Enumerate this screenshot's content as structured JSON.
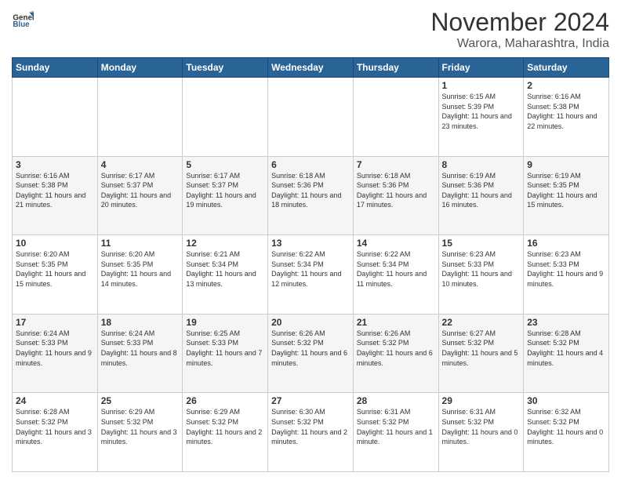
{
  "logo": {
    "text_general": "General",
    "text_blue": "Blue"
  },
  "header": {
    "month_title": "November 2024",
    "location": "Warora, Maharashtra, India"
  },
  "weekdays": [
    "Sunday",
    "Monday",
    "Tuesday",
    "Wednesday",
    "Thursday",
    "Friday",
    "Saturday"
  ],
  "weeks": [
    [
      {
        "day": "",
        "info": ""
      },
      {
        "day": "",
        "info": ""
      },
      {
        "day": "",
        "info": ""
      },
      {
        "day": "",
        "info": ""
      },
      {
        "day": "",
        "info": ""
      },
      {
        "day": "1",
        "info": "Sunrise: 6:15 AM\nSunset: 5:39 PM\nDaylight: 11 hours and 23 minutes."
      },
      {
        "day": "2",
        "info": "Sunrise: 6:16 AM\nSunset: 5:38 PM\nDaylight: 11 hours and 22 minutes."
      }
    ],
    [
      {
        "day": "3",
        "info": "Sunrise: 6:16 AM\nSunset: 5:38 PM\nDaylight: 11 hours and 21 minutes."
      },
      {
        "day": "4",
        "info": "Sunrise: 6:17 AM\nSunset: 5:37 PM\nDaylight: 11 hours and 20 minutes."
      },
      {
        "day": "5",
        "info": "Sunrise: 6:17 AM\nSunset: 5:37 PM\nDaylight: 11 hours and 19 minutes."
      },
      {
        "day": "6",
        "info": "Sunrise: 6:18 AM\nSunset: 5:36 PM\nDaylight: 11 hours and 18 minutes."
      },
      {
        "day": "7",
        "info": "Sunrise: 6:18 AM\nSunset: 5:36 PM\nDaylight: 11 hours and 17 minutes."
      },
      {
        "day": "8",
        "info": "Sunrise: 6:19 AM\nSunset: 5:36 PM\nDaylight: 11 hours and 16 minutes."
      },
      {
        "day": "9",
        "info": "Sunrise: 6:19 AM\nSunset: 5:35 PM\nDaylight: 11 hours and 15 minutes."
      }
    ],
    [
      {
        "day": "10",
        "info": "Sunrise: 6:20 AM\nSunset: 5:35 PM\nDaylight: 11 hours and 15 minutes."
      },
      {
        "day": "11",
        "info": "Sunrise: 6:20 AM\nSunset: 5:35 PM\nDaylight: 11 hours and 14 minutes."
      },
      {
        "day": "12",
        "info": "Sunrise: 6:21 AM\nSunset: 5:34 PM\nDaylight: 11 hours and 13 minutes."
      },
      {
        "day": "13",
        "info": "Sunrise: 6:22 AM\nSunset: 5:34 PM\nDaylight: 11 hours and 12 minutes."
      },
      {
        "day": "14",
        "info": "Sunrise: 6:22 AM\nSunset: 5:34 PM\nDaylight: 11 hours and 11 minutes."
      },
      {
        "day": "15",
        "info": "Sunrise: 6:23 AM\nSunset: 5:33 PM\nDaylight: 11 hours and 10 minutes."
      },
      {
        "day": "16",
        "info": "Sunrise: 6:23 AM\nSunset: 5:33 PM\nDaylight: 11 hours and 9 minutes."
      }
    ],
    [
      {
        "day": "17",
        "info": "Sunrise: 6:24 AM\nSunset: 5:33 PM\nDaylight: 11 hours and 9 minutes."
      },
      {
        "day": "18",
        "info": "Sunrise: 6:24 AM\nSunset: 5:33 PM\nDaylight: 11 hours and 8 minutes."
      },
      {
        "day": "19",
        "info": "Sunrise: 6:25 AM\nSunset: 5:33 PM\nDaylight: 11 hours and 7 minutes."
      },
      {
        "day": "20",
        "info": "Sunrise: 6:26 AM\nSunset: 5:32 PM\nDaylight: 11 hours and 6 minutes."
      },
      {
        "day": "21",
        "info": "Sunrise: 6:26 AM\nSunset: 5:32 PM\nDaylight: 11 hours and 6 minutes."
      },
      {
        "day": "22",
        "info": "Sunrise: 6:27 AM\nSunset: 5:32 PM\nDaylight: 11 hours and 5 minutes."
      },
      {
        "day": "23",
        "info": "Sunrise: 6:28 AM\nSunset: 5:32 PM\nDaylight: 11 hours and 4 minutes."
      }
    ],
    [
      {
        "day": "24",
        "info": "Sunrise: 6:28 AM\nSunset: 5:32 PM\nDaylight: 11 hours and 3 minutes."
      },
      {
        "day": "25",
        "info": "Sunrise: 6:29 AM\nSunset: 5:32 PM\nDaylight: 11 hours and 3 minutes."
      },
      {
        "day": "26",
        "info": "Sunrise: 6:29 AM\nSunset: 5:32 PM\nDaylight: 11 hours and 2 minutes."
      },
      {
        "day": "27",
        "info": "Sunrise: 6:30 AM\nSunset: 5:32 PM\nDaylight: 11 hours and 2 minutes."
      },
      {
        "day": "28",
        "info": "Sunrise: 6:31 AM\nSunset: 5:32 PM\nDaylight: 11 hours and 1 minute."
      },
      {
        "day": "29",
        "info": "Sunrise: 6:31 AM\nSunset: 5:32 PM\nDaylight: 11 hours and 0 minutes."
      },
      {
        "day": "30",
        "info": "Sunrise: 6:32 AM\nSunset: 5:32 PM\nDaylight: 11 hours and 0 minutes."
      }
    ]
  ]
}
